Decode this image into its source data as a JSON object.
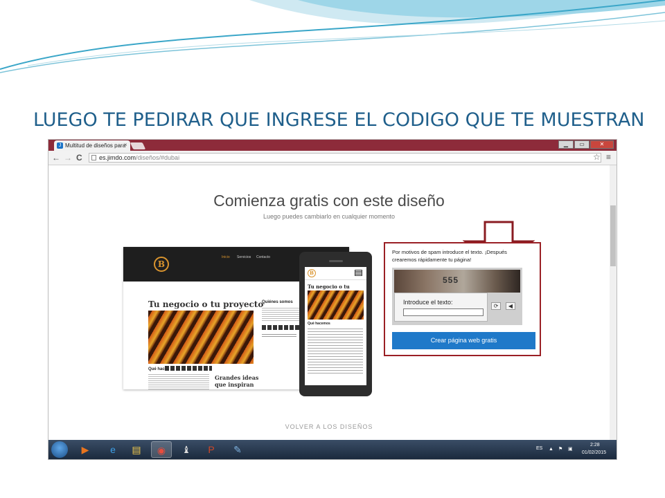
{
  "slide": {
    "title": "LUEGO TE PEDIRAR QUE INGRESE EL CODIGO QUE TE MUESTRAN"
  },
  "browser": {
    "tab_title": "Multitud de diseños para",
    "tab_close": "×",
    "url_domain": "es.jimdo.com",
    "url_path": "/diseños/#dubai",
    "window_buttons": [
      "▁",
      "▭",
      "✕"
    ],
    "nav": {
      "back": "←",
      "forward": "→",
      "reload": "C"
    },
    "star": "☆",
    "menu": "≡"
  },
  "page": {
    "heading": "Comienza gratis con este diseño",
    "subheading": "Luego puedes cambiarlo en cualquier momento",
    "back_link": "VOLVER A LOS DISEÑOS"
  },
  "preview": {
    "logo_letter": "B",
    "nav_items": [
      "Inicio",
      "Servicios",
      "Contacto"
    ],
    "desktop_title": "Tu negocio o tu proyecto",
    "que_hacemos": "Qué hacemos",
    "quienes_somos": "Quiénes somos",
    "grandes_ideas": "Grandes ideas que inspiran",
    "mobile_title": "Tu negocio o tu proyecto",
    "mobile_que_hacemos": "Qué hacemos"
  },
  "captcha": {
    "note": "Por motivos de spam introduce el texto. ¡Después crearemos rápidamente tu página!",
    "image_text": "555",
    "label": "Introduce el texto:",
    "input_value": "",
    "refresh_icon_glyph": "⟳",
    "audio_icon_glyph": "◀",
    "submit": "Crear página web gratis"
  },
  "taskbar": {
    "lang": "ES",
    "time": "2:28",
    "date": "01/02/2015",
    "apps": [
      {
        "name": "media-player",
        "glyph": "▶",
        "color": "#e8741e"
      },
      {
        "name": "internet-explorer",
        "glyph": "e",
        "color": "#3ea0e8"
      },
      {
        "name": "file-explorer",
        "glyph": "▤",
        "color": "#f2c94c"
      },
      {
        "name": "chrome",
        "glyph": "◉",
        "color": "#e84c3d"
      },
      {
        "name": "chess",
        "glyph": "♝",
        "color": "#dddddd"
      },
      {
        "name": "powerpoint",
        "glyph": "P",
        "color": "#d24726"
      },
      {
        "name": "paint",
        "glyph": "✎",
        "color": "#7fb3e0"
      }
    ]
  },
  "colors": {
    "title": "#1f5f8b",
    "tab_bar": "#8d2b3a",
    "highlight_border": "#9a1f24",
    "submit_button": "#1f79c9",
    "logo_accent": "#d9942e"
  }
}
